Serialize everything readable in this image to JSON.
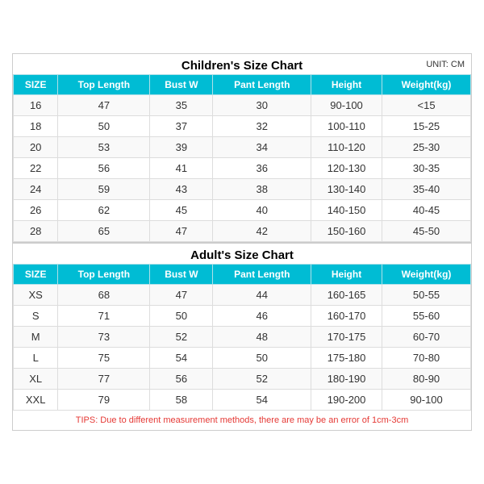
{
  "children_title": "Children's Size Chart",
  "adult_title": "Adult's Size Chart",
  "unit_label": "UNIT: CM",
  "tips": "TIPS: Due to different measurement methods, there are may be an error of 1cm-3cm",
  "headers": [
    "SIZE",
    "Top Length",
    "Bust W",
    "Pant Length",
    "Height",
    "Weight(kg)"
  ],
  "children_rows": [
    [
      "16",
      "47",
      "35",
      "30",
      "90-100",
      "<15"
    ],
    [
      "18",
      "50",
      "37",
      "32",
      "100-110",
      "15-25"
    ],
    [
      "20",
      "53",
      "39",
      "34",
      "110-120",
      "25-30"
    ],
    [
      "22",
      "56",
      "41",
      "36",
      "120-130",
      "30-35"
    ],
    [
      "24",
      "59",
      "43",
      "38",
      "130-140",
      "35-40"
    ],
    [
      "26",
      "62",
      "45",
      "40",
      "140-150",
      "40-45"
    ],
    [
      "28",
      "65",
      "47",
      "42",
      "150-160",
      "45-50"
    ]
  ],
  "adult_rows": [
    [
      "XS",
      "68",
      "47",
      "44",
      "160-165",
      "50-55"
    ],
    [
      "S",
      "71",
      "50",
      "46",
      "160-170",
      "55-60"
    ],
    [
      "M",
      "73",
      "52",
      "48",
      "170-175",
      "60-70"
    ],
    [
      "L",
      "75",
      "54",
      "50",
      "175-180",
      "70-80"
    ],
    [
      "XL",
      "77",
      "56",
      "52",
      "180-190",
      "80-90"
    ],
    [
      "XXL",
      "79",
      "58",
      "54",
      "190-200",
      "90-100"
    ]
  ]
}
